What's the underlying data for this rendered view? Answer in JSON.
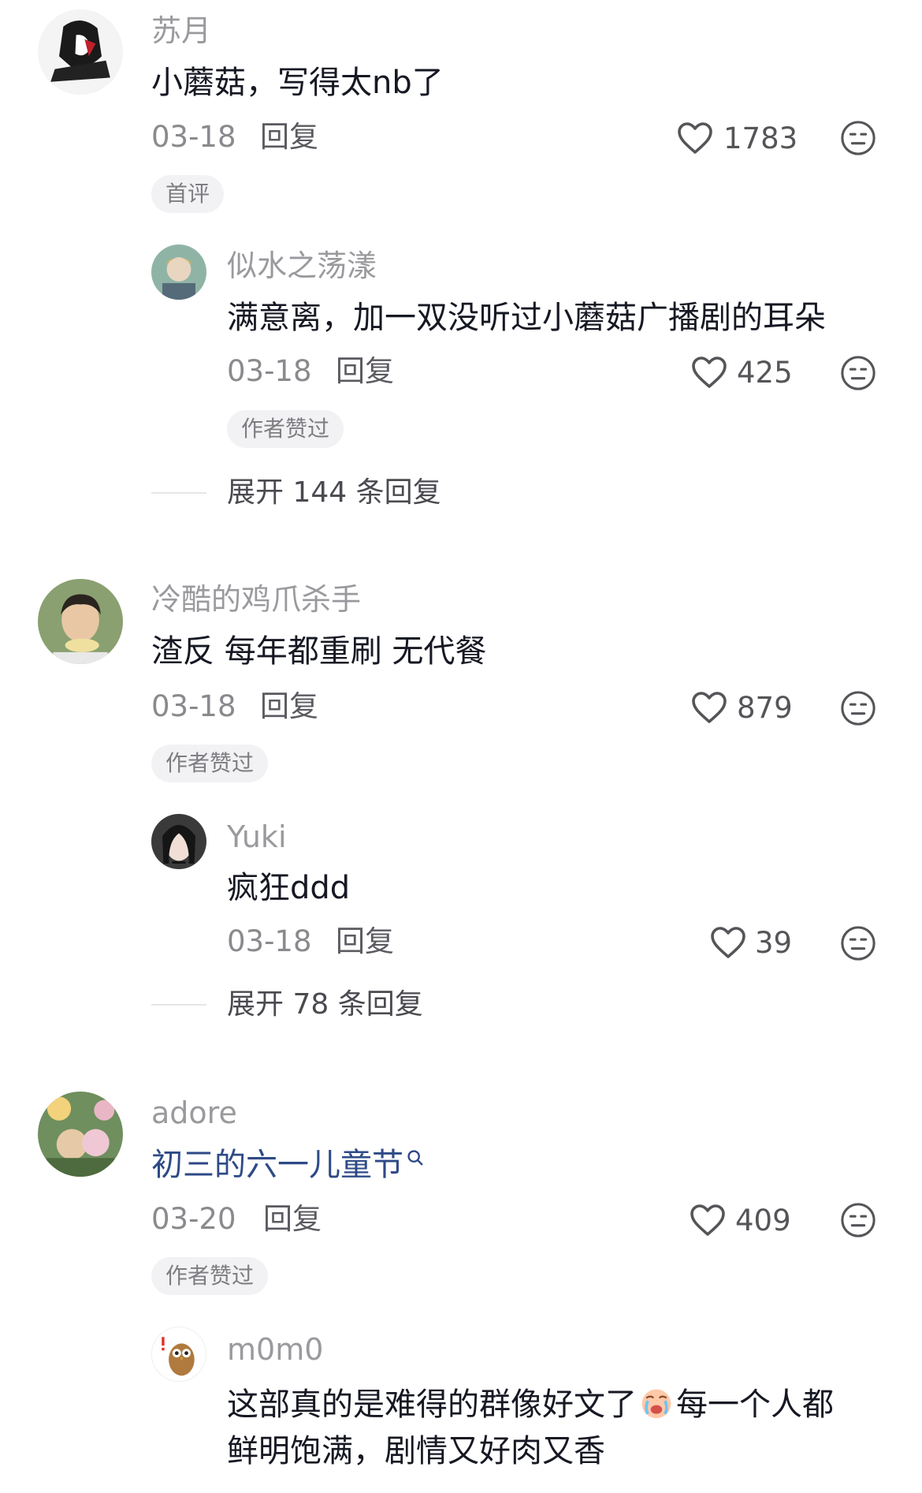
{
  "comments": [
    {
      "user": "苏月",
      "text": "小蘑菇，写得太nb了",
      "date": "03-18",
      "reply_label": "回复",
      "likes": "1783",
      "badge": "首评",
      "replies": [
        {
          "user": "似水之荡漾",
          "text": "满意离，加一双没听过小蘑菇广播剧的耳朵",
          "date": "03-18",
          "reply_label": "回复",
          "likes": "425",
          "badge": "作者赞过"
        }
      ],
      "expand_label": "展开 144 条回复"
    },
    {
      "user": "冷酷的鸡爪杀手",
      "text": "渣反 每年都重刷 无代餐",
      "date": "03-18",
      "reply_label": "回复",
      "likes": "879",
      "badge": "作者赞过",
      "replies": [
        {
          "user": "Yuki",
          "text": "疯狂ddd",
          "date": "03-18",
          "reply_label": "回复",
          "likes": "39"
        }
      ],
      "expand_label": "展开 78 条回复"
    },
    {
      "user": "adore",
      "text": "初三的六一儿童节",
      "date": "03-20",
      "reply_label": "回复",
      "likes": "409",
      "badge": "作者赞过",
      "replies": [
        {
          "user": "m0m0",
          "text_line1": "这部真的是难得的群像好文了",
          "text_line1b": "每一个人都",
          "text_line2": "鲜明饱满，剧情又好肉又香"
        }
      ]
    }
  ],
  "icons": {
    "like": "heart-outline-icon",
    "react": "neutral-face-icon",
    "search": "search-small-icon",
    "cry_emoji": "crying-face-emoji"
  },
  "colors": {
    "link_text": "#2e4a86",
    "secondary_text": "#9a9a9e",
    "badge_bg": "#f2f2f4"
  }
}
